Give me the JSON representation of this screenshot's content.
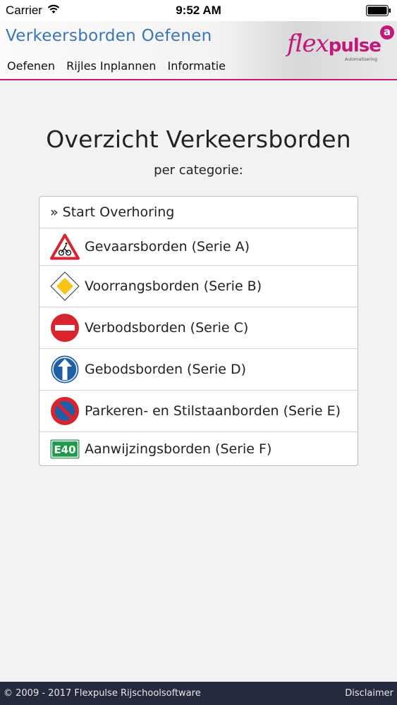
{
  "status": {
    "carrier": "Carrier",
    "time": "9:52 AM"
  },
  "header": {
    "app_title": "Verkeersborden Oefenen",
    "nav": [
      "Oefenen",
      "Rijles Inplannen",
      "Informatie"
    ],
    "logo": {
      "brand_a": "flex",
      "brand_b": "pulse",
      "sub": "Automatisering",
      "badge": "a"
    }
  },
  "main": {
    "title": "Overzicht Verkeersborden",
    "subtitle": "per categorie:",
    "start": "» Start Overhoring",
    "items": [
      {
        "label": "Gevaarsborden (Serie A)",
        "icon": "warning-triangle-icon"
      },
      {
        "label": "Voorrangsborden (Serie B)",
        "icon": "priority-diamond-icon"
      },
      {
        "label": "Verbodsborden (Serie C)",
        "icon": "no-entry-icon"
      },
      {
        "label": "Gebodsborden (Serie D)",
        "icon": "mandatory-arrow-icon"
      },
      {
        "label": "Parkeren- en Stilstaanborden (Serie E)",
        "icon": "no-parking-icon"
      },
      {
        "label": "Aanwijzingsborden (Serie F)",
        "icon": "route-e40-icon",
        "icon_text": "E40"
      }
    ]
  },
  "footer": {
    "copyright": "© 2009 - 2017 Flexpulse Rijschoolsoftware",
    "disclaimer": "Disclaimer"
  },
  "colors": {
    "accent": "#c2187a",
    "title_blue": "#3a75b8",
    "footer_bg": "#262a3e"
  }
}
